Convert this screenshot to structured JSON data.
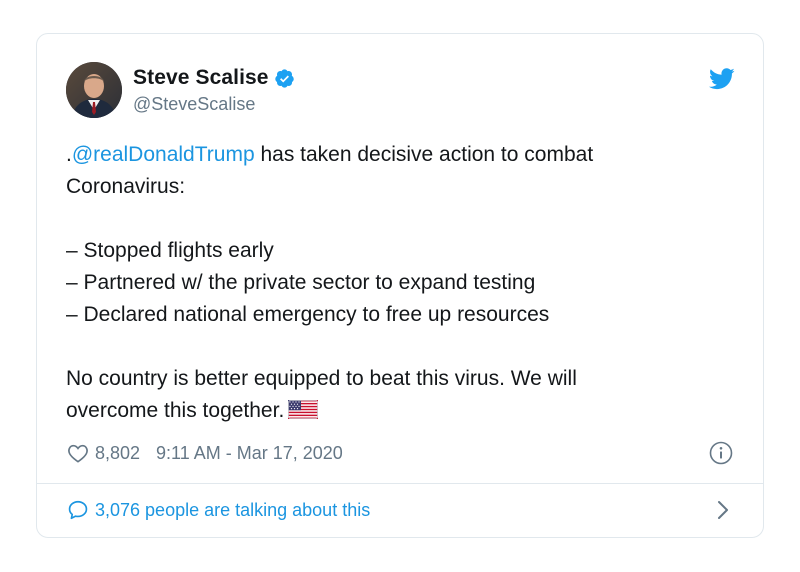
{
  "tweet": {
    "author": {
      "display_name": "Steve Scalise",
      "handle": "@SteveScalise",
      "verified": true
    },
    "text": {
      "prefix": ".",
      "mention": "@realDonaldTrump",
      "line1_rest": " has taken decisive action to combat",
      "line2": "Coronavirus:",
      "bullets": [
        "– Stopped flights early",
        "– Partnered w/ the private sector to expand testing",
        "– Declared national emergency to free up resources"
      ],
      "closing_line1": "No country is better equipped to beat this virus. We will",
      "closing_line2": "overcome this together."
    },
    "likes": "8,802",
    "timestamp": "9:11 AM - Mar 17, 2020",
    "conversation": "3,076 people are talking about this"
  },
  "icons": {
    "verified": "verified-badge-icon",
    "brand": "twitter-bird-icon",
    "like": "heart-icon",
    "info": "info-icon",
    "reply": "speech-bubble-icon",
    "more": "chevron-right-icon",
    "emoji": "us-flag-icon"
  },
  "colors": {
    "brand_blue": "#1da1f2",
    "link_blue": "#1b95e0",
    "text_primary": "#14171a",
    "text_secondary": "#657786",
    "border": "#e1e8ed"
  }
}
